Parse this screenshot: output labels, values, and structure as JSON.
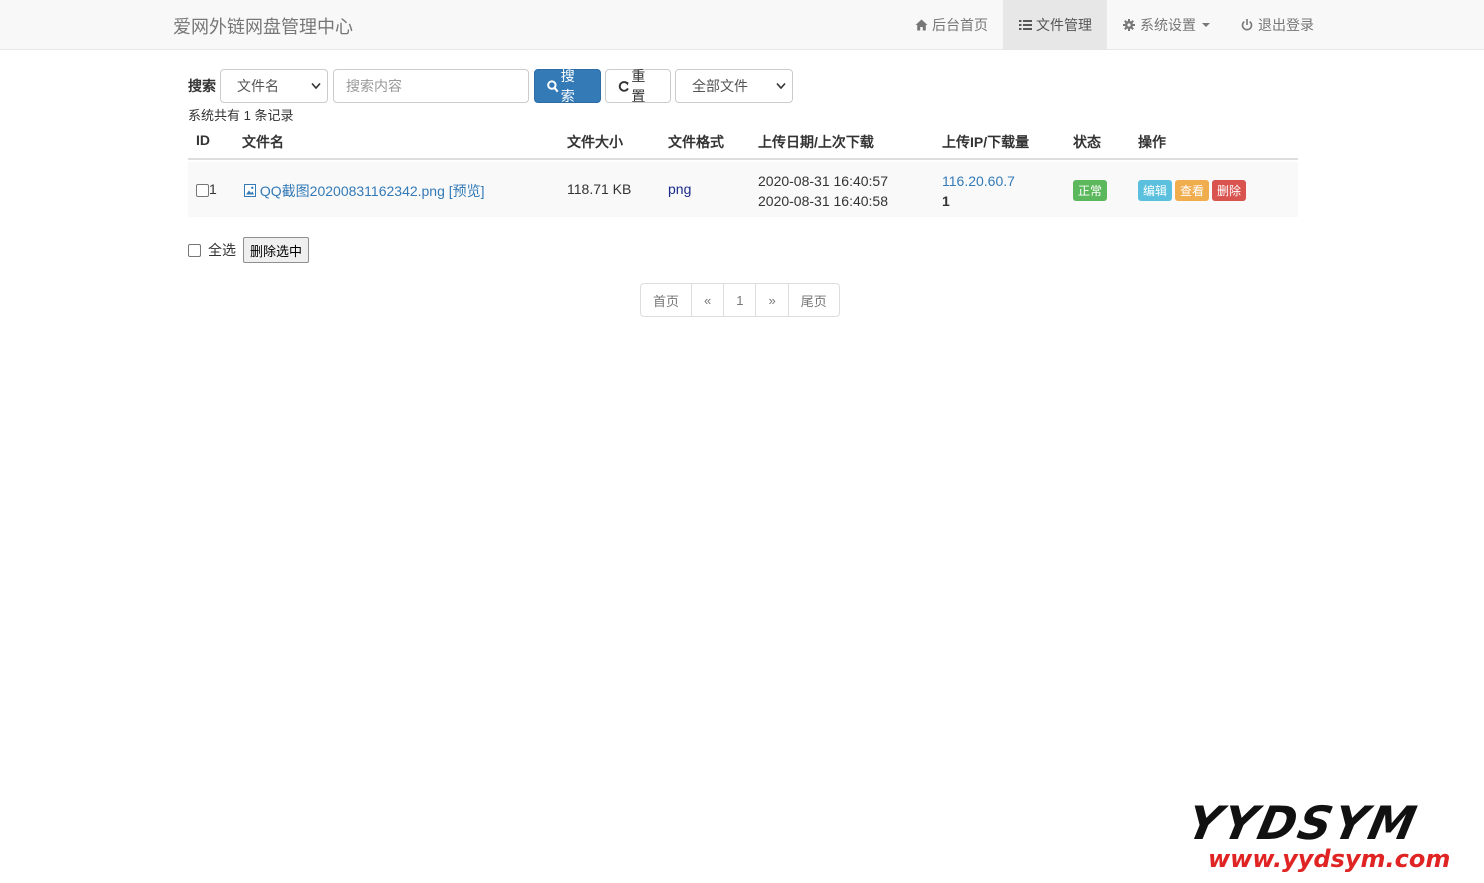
{
  "navbar": {
    "brand": "爱网外链网盘管理中心",
    "items": [
      {
        "label": "后台首页",
        "icon": "home-icon"
      },
      {
        "label": "文件管理",
        "icon": "list-icon",
        "active": true
      },
      {
        "label": "系统设置",
        "icon": "gear-icon",
        "dropdown": true
      },
      {
        "label": "退出登录",
        "icon": "power-icon"
      }
    ]
  },
  "search": {
    "label": "搜索",
    "field_select": "文件名",
    "placeholder": "搜索内容",
    "search_button": "搜索",
    "reset_button": "重置",
    "filter_select": "全部文件",
    "primary_color": "#337ab7"
  },
  "summary": "系统共有 1 条记录",
  "table": {
    "headers": {
      "id": "ID",
      "name": "文件名",
      "size": "文件大小",
      "format": "文件格式",
      "dates": "上传日期/上次下载",
      "ip": "上传IP/下载量",
      "status": "状态",
      "actions": "操作"
    },
    "rows": [
      {
        "id": "1",
        "name": "QQ截图20200831162342.png",
        "preview": "[预览]",
        "size": "118.71 KB",
        "format": "png",
        "upload_date": "2020-08-31 16:40:57",
        "last_download": "2020-08-31 16:40:58",
        "ip": "116.20.60.7",
        "downloads": "1",
        "status": "正常",
        "actions": {
          "edit": "编辑",
          "view": "查看",
          "delete": "删除"
        }
      }
    ]
  },
  "bulk": {
    "select_all": "全选",
    "delete_selected": "删除选中"
  },
  "pagination": {
    "first": "首页",
    "prev": "«",
    "current": "1",
    "next": "»",
    "last": "尾页"
  },
  "watermark": {
    "big": "YYDSYM",
    "small": "www.yydsym.com"
  }
}
